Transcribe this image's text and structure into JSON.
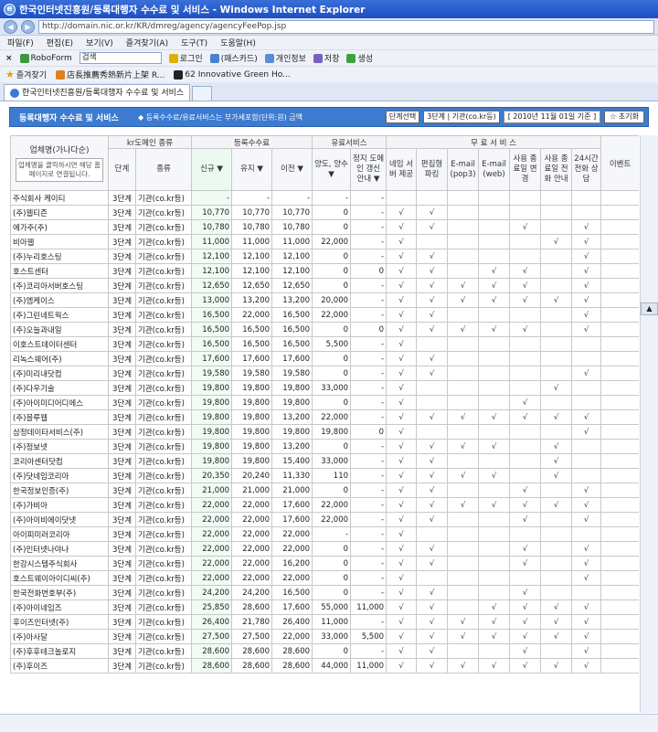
{
  "window": {
    "title": "한국인터넷진흥원/등록대행자 수수료 및 서비스 - Windows Internet Explorer"
  },
  "address": {
    "url": "http://domain.nic.or.kr/KR/dmreg/agency/agencyFeePop.jsp"
  },
  "menu": [
    "파일(F)",
    "편집(E)",
    "보기(V)",
    "즐겨찾기(A)",
    "도구(T)",
    "도움말(H)"
  ],
  "toolbar": {
    "close": "×",
    "roboform": "RoboForm",
    "search_value": "검색",
    "login": "로그인",
    "passcard": "(패스카드)",
    "personal": "개인정보",
    "save": "저장",
    "generate": "생성"
  },
  "favorites": {
    "label": "즐겨찾기",
    "items": [
      "店長推薦秀熱新片上架 R...",
      "62 Innovative Green Ho..."
    ]
  },
  "tabs": {
    "active": "한국인터넷진흥원/등록대행자 수수료 및 서비스"
  },
  "page": {
    "title": "등록대행자 수수료 및 서비스",
    "note": "◆ 등록수수료/유료서비스는 부가세포함(단위:원) 금액",
    "filter1": "단계선택",
    "filter2": "3단계 | 기관(co.kr등)",
    "date": "[ 2010년 11월 01일 기준 ]",
    "reset": "☆ 초기화"
  },
  "table": {
    "group_headers": {
      "company": "업체명(가나다순)",
      "kr_type": "kr도메인 종류",
      "fee": "등록수수료",
      "paid": "유료서비스",
      "free": "무 료 서 비 스",
      "event": "이벤트"
    },
    "company_note": "업체명을 클릭하시면 해당 홈페이지로 연결됩니다.",
    "sub_headers": {
      "stage": "단계",
      "kind": "종류",
      "new": "신규 ▼",
      "keep": "유지 ▼",
      "transfer": "이전 ▼",
      "assign": "양도, 양수 ▼",
      "parking_info": "정지 도메인 갱신 안내 ▼",
      "name_server": "네임 서버 제공",
      "edit_parking": "편집형 파킹",
      "email_pop3": "E-mail (pop3)",
      "email_web": "E-mail (web)",
      "expiry_change": "사용 종료일 변경",
      "expiry_phone": "사용 종료일 전화 안내",
      "support24": "24시간 전화 상담"
    },
    "rows": [
      {
        "name": "주식회사 케이티",
        "stage": "3단계",
        "kind": "기관(co.kr등)",
        "new": "-",
        "keep": "-",
        "transfer": "-",
        "assign": "-",
        "parking": "-",
        "ns": "",
        "ep": "",
        "pop3": "",
        "web": "",
        "chg": "",
        "phone": "",
        "s24": ""
      },
      {
        "name": "(주)웹티즌",
        "stage": "3단계",
        "kind": "기관(co.kr등)",
        "new": "10,770",
        "keep": "10,770",
        "transfer": "10,770",
        "assign": "0",
        "parking": "-",
        "ns": "√",
        "ep": "√",
        "pop3": "",
        "web": "",
        "chg": "",
        "phone": "",
        "s24": ""
      },
      {
        "name": "에가주(주)",
        "stage": "3단계",
        "kind": "기관(co.kr등)",
        "new": "10,780",
        "keep": "10,780",
        "transfer": "10,780",
        "assign": "0",
        "parking": "-",
        "ns": "√",
        "ep": "√",
        "pop3": "",
        "web": "",
        "chg": "√",
        "phone": "",
        "s24": "√"
      },
      {
        "name": "비아웹",
        "stage": "3단계",
        "kind": "기관(co.kr등)",
        "new": "11,000",
        "keep": "11,000",
        "transfer": "11,000",
        "assign": "22,000",
        "parking": "-",
        "ns": "√",
        "ep": "",
        "pop3": "",
        "web": "",
        "chg": "",
        "phone": "√",
        "s24": "√"
      },
      {
        "name": "(주)누리호스팅",
        "stage": "3단계",
        "kind": "기관(co.kr등)",
        "new": "12,100",
        "keep": "12,100",
        "transfer": "12,100",
        "assign": "0",
        "parking": "-",
        "ns": "√",
        "ep": "√",
        "pop3": "",
        "web": "",
        "chg": "",
        "phone": "",
        "s24": "√"
      },
      {
        "name": "호스트센터",
        "stage": "3단계",
        "kind": "기관(co.kr등)",
        "new": "12,100",
        "keep": "12,100",
        "transfer": "12,100",
        "assign": "0",
        "parking": "0",
        "ns": "√",
        "ep": "√",
        "pop3": "",
        "web": "√",
        "chg": "√",
        "phone": "",
        "s24": "√"
      },
      {
        "name": "(주)코리아서버호스팅",
        "stage": "3단계",
        "kind": "기관(co.kr등)",
        "new": "12,650",
        "keep": "12,650",
        "transfer": "12,650",
        "assign": "0",
        "parking": "-",
        "ns": "√",
        "ep": "√",
        "pop3": "√",
        "web": "√",
        "chg": "√",
        "phone": "",
        "s24": "√"
      },
      {
        "name": "(주)엠케이스",
        "stage": "3단계",
        "kind": "기관(co.kr등)",
        "new": "13,000",
        "keep": "13,200",
        "transfer": "13,200",
        "assign": "20,000",
        "parking": "-",
        "ns": "√",
        "ep": "√",
        "pop3": "√",
        "web": "√",
        "chg": "√",
        "phone": "√",
        "s24": "√"
      },
      {
        "name": "(주)그린네트웍스",
        "stage": "3단계",
        "kind": "기관(co.kr등)",
        "new": "16,500",
        "keep": "22,000",
        "transfer": "16,500",
        "assign": "22,000",
        "parking": "-",
        "ns": "√",
        "ep": "√",
        "pop3": "",
        "web": "",
        "chg": "",
        "phone": "",
        "s24": "√"
      },
      {
        "name": "(주)오늘과내일",
        "stage": "3단계",
        "kind": "기관(co.kr등)",
        "new": "16,500",
        "keep": "16,500",
        "transfer": "16,500",
        "assign": "0",
        "parking": "0",
        "ns": "√",
        "ep": "√",
        "pop3": "√",
        "web": "√",
        "chg": "√",
        "phone": "",
        "s24": "√"
      },
      {
        "name": "이호스트데이터센터",
        "stage": "3단계",
        "kind": "기관(co.kr등)",
        "new": "16,500",
        "keep": "16,500",
        "transfer": "16,500",
        "assign": "5,500",
        "parking": "-",
        "ns": "√",
        "ep": "",
        "pop3": "",
        "web": "",
        "chg": "",
        "phone": "",
        "s24": ""
      },
      {
        "name": "리녹스웨어(주)",
        "stage": "3단계",
        "kind": "기관(co.kr등)",
        "new": "17,600",
        "keep": "17,600",
        "transfer": "17,600",
        "assign": "0",
        "parking": "-",
        "ns": "√",
        "ep": "√",
        "pop3": "",
        "web": "",
        "chg": "",
        "phone": "",
        "s24": ""
      },
      {
        "name": "(주)미리내닷컴",
        "stage": "3단계",
        "kind": "기관(co.kr등)",
        "new": "19,580",
        "keep": "19,580",
        "transfer": "19,580",
        "assign": "0",
        "parking": "-",
        "ns": "√",
        "ep": "√",
        "pop3": "",
        "web": "",
        "chg": "",
        "phone": "",
        "s24": "√"
      },
      {
        "name": "(주)다우기술",
        "stage": "3단계",
        "kind": "기관(co.kr등)",
        "new": "19,800",
        "keep": "19,800",
        "transfer": "19,800",
        "assign": "33,000",
        "parking": "-",
        "ns": "√",
        "ep": "",
        "pop3": "",
        "web": "",
        "chg": "",
        "phone": "√",
        "s24": ""
      },
      {
        "name": "(주)아이미디어디에스",
        "stage": "3단계",
        "kind": "기관(co.kr등)",
        "new": "19,800",
        "keep": "19,800",
        "transfer": "19,800",
        "assign": "0",
        "parking": "-",
        "ns": "√",
        "ep": "",
        "pop3": "",
        "web": "",
        "chg": "√",
        "phone": "",
        "s24": ""
      },
      {
        "name": "(주)블루웹",
        "stage": "3단계",
        "kind": "기관(co.kr등)",
        "new": "19,800",
        "keep": "19,800",
        "transfer": "13,200",
        "assign": "22,000",
        "parking": "-",
        "ns": "√",
        "ep": "√",
        "pop3": "√",
        "web": "√",
        "chg": "√",
        "phone": "√",
        "s24": "√"
      },
      {
        "name": "삼정데이타서비스(주)",
        "stage": "3단계",
        "kind": "기관(co.kr등)",
        "new": "19,800",
        "keep": "19,800",
        "transfer": "19,800",
        "assign": "19,800",
        "parking": "0",
        "ns": "√",
        "ep": "",
        "pop3": "",
        "web": "",
        "chg": "",
        "phone": "",
        "s24": "√"
      },
      {
        "name": "(주)정보넷",
        "stage": "3단계",
        "kind": "기관(co.kr등)",
        "new": "19,800",
        "keep": "19,800",
        "transfer": "13,200",
        "assign": "0",
        "parking": "-",
        "ns": "√",
        "ep": "√",
        "pop3": "√",
        "web": "√",
        "chg": "",
        "phone": "√",
        "s24": ""
      },
      {
        "name": "코리아센터닷컴",
        "stage": "3단계",
        "kind": "기관(co.kr등)",
        "new": "19,800",
        "keep": "19,800",
        "transfer": "15,400",
        "assign": "33,000",
        "parking": "-",
        "ns": "√",
        "ep": "√",
        "pop3": "",
        "web": "",
        "chg": "",
        "phone": "√",
        "s24": ""
      },
      {
        "name": "(주)닷네임코리아",
        "stage": "3단계",
        "kind": "기관(co.kr등)",
        "new": "20,350",
        "keep": "20,240",
        "transfer": "11,330",
        "assign": "110",
        "parking": "-",
        "ns": "√",
        "ep": "√",
        "pop3": "√",
        "web": "√",
        "chg": "",
        "phone": "√",
        "s24": ""
      },
      {
        "name": "한국정보인증(주)",
        "stage": "3단계",
        "kind": "기관(co.kr등)",
        "new": "21,000",
        "keep": "21,000",
        "transfer": "21,000",
        "assign": "0",
        "parking": "-",
        "ns": "√",
        "ep": "√",
        "pop3": "",
        "web": "",
        "chg": "√",
        "phone": "",
        "s24": "√"
      },
      {
        "name": "(주)가비아",
        "stage": "3단계",
        "kind": "기관(co.kr등)",
        "new": "22,000",
        "keep": "22,000",
        "transfer": "17,600",
        "assign": "22,000",
        "parking": "-",
        "ns": "√",
        "ep": "√",
        "pop3": "√",
        "web": "√",
        "chg": "√",
        "phone": "√",
        "s24": "√"
      },
      {
        "name": "(주)아이비에이닷넷",
        "stage": "3단계",
        "kind": "기관(co.kr등)",
        "new": "22,000",
        "keep": "22,000",
        "transfer": "17,600",
        "assign": "22,000",
        "parking": "-",
        "ns": "√",
        "ep": "√",
        "pop3": "",
        "web": "",
        "chg": "√",
        "phone": "",
        "s24": "√"
      },
      {
        "name": "아이피미러코리아",
        "stage": "3단계",
        "kind": "기관(co.kr등)",
        "new": "22,000",
        "keep": "22,000",
        "transfer": "22,000",
        "assign": "-",
        "parking": "-",
        "ns": "√",
        "ep": "",
        "pop3": "",
        "web": "",
        "chg": "",
        "phone": "",
        "s24": ""
      },
      {
        "name": "(주)인터넷나야나",
        "stage": "3단계",
        "kind": "기관(co.kr등)",
        "new": "22,000",
        "keep": "22,000",
        "transfer": "22,000",
        "assign": "0",
        "parking": "-",
        "ns": "√",
        "ep": "√",
        "pop3": "",
        "web": "",
        "chg": "√",
        "phone": "",
        "s24": "√"
      },
      {
        "name": "한강시스템주식회사",
        "stage": "3단계",
        "kind": "기관(co.kr등)",
        "new": "22,000",
        "keep": "22,000",
        "transfer": "16,200",
        "assign": "0",
        "parking": "-",
        "ns": "√",
        "ep": "√",
        "pop3": "",
        "web": "",
        "chg": "√",
        "phone": "",
        "s24": "√"
      },
      {
        "name": "호스트웨이아이디씨(주)",
        "stage": "3단계",
        "kind": "기관(co.kr등)",
        "new": "22,000",
        "keep": "22,000",
        "transfer": "22,000",
        "assign": "0",
        "parking": "-",
        "ns": "√",
        "ep": "",
        "pop3": "",
        "web": "",
        "chg": "",
        "phone": "",
        "s24": "√"
      },
      {
        "name": "한국전화번호부(주)",
        "stage": "3단계",
        "kind": "기관(co.kr등)",
        "new": "24,200",
        "keep": "24,200",
        "transfer": "16,500",
        "assign": "0",
        "parking": "-",
        "ns": "√",
        "ep": "√",
        "pop3": "",
        "web": "",
        "chg": "√",
        "phone": "",
        "s24": ""
      },
      {
        "name": "(주)아이네임즈",
        "stage": "3단계",
        "kind": "기관(co.kr등)",
        "new": "25,850",
        "keep": "28,600",
        "transfer": "17,600",
        "assign": "55,000",
        "parking": "11,000",
        "ns": "√",
        "ep": "√",
        "pop3": "",
        "web": "√",
        "chg": "√",
        "phone": "√",
        "s24": "√"
      },
      {
        "name": "후이즈인터넷(주)",
        "stage": "3단계",
        "kind": "기관(co.kr등)",
        "new": "26,400",
        "keep": "21,780",
        "transfer": "26,400",
        "assign": "11,000",
        "parking": "-",
        "ns": "√",
        "ep": "√",
        "pop3": "√",
        "web": "√",
        "chg": "√",
        "phone": "√",
        "s24": "√"
      },
      {
        "name": "(주)아사달",
        "stage": "3단계",
        "kind": "기관(co.kr등)",
        "new": "27,500",
        "keep": "27,500",
        "transfer": "22,000",
        "assign": "33,000",
        "parking": "5,500",
        "ns": "√",
        "ep": "√",
        "pop3": "√",
        "web": "√",
        "chg": "√",
        "phone": "√",
        "s24": "√"
      },
      {
        "name": "(주)후후테크놀로지",
        "stage": "3단계",
        "kind": "기관(co.kr등)",
        "new": "28,600",
        "keep": "28,600",
        "transfer": "28,600",
        "assign": "0",
        "parking": "-",
        "ns": "√",
        "ep": "√",
        "pop3": "",
        "web": "",
        "chg": "√",
        "phone": "",
        "s24": "√"
      },
      {
        "name": "(주)후이즈",
        "stage": "3단계",
        "kind": "기관(co.kr등)",
        "new": "28,600",
        "keep": "28,600",
        "transfer": "28,600",
        "assign": "44,000",
        "parking": "11,000",
        "ns": "√",
        "ep": "√",
        "pop3": "√",
        "web": "√",
        "chg": "√",
        "phone": "√",
        "s24": "√"
      }
    ]
  }
}
